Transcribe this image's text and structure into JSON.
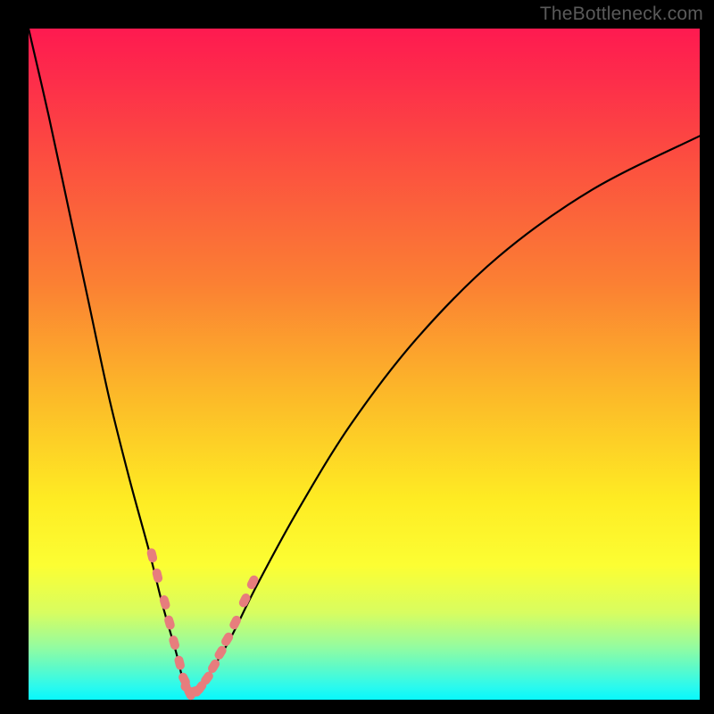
{
  "watermark": "TheBottleneck.com",
  "colors": {
    "frame": "#000000",
    "curve": "#000000",
    "marker": "#e77d7d"
  },
  "chart_data": {
    "type": "line",
    "title": "",
    "xlabel": "",
    "ylabel": "",
    "xlim": [
      0,
      100
    ],
    "ylim": [
      0,
      100
    ],
    "grid": false,
    "description": "V-shaped bottleneck curve with minimum near x≈24. Background gradient encodes severity (red top → green bottom). Coral markers highlight points near the minimum.",
    "series": [
      {
        "name": "bottleneck-curve",
        "x": [
          0,
          3,
          6,
          9,
          12,
          15,
          18,
          20,
          22,
          23,
          24,
          25,
          27,
          30,
          34,
          40,
          48,
          58,
          70,
          84,
          100
        ],
        "values": [
          100,
          87,
          73,
          59,
          45,
          33,
          22,
          14,
          7,
          3,
          1,
          1.3,
          4,
          9,
          17,
          28,
          41,
          54,
          66,
          76,
          84
        ]
      }
    ],
    "markers": {
      "name": "highlighted-points",
      "x": [
        18.4,
        19.2,
        20.3,
        21.0,
        21.7,
        22.5,
        23.2,
        24.0,
        24.8,
        25.6,
        26.6,
        27.6,
        28.6,
        29.6,
        30.8,
        32.2,
        33.4
      ],
      "values": [
        21.5,
        18.5,
        14.5,
        11.5,
        8.5,
        5.5,
        3.0,
        1.0,
        1.3,
        1.8,
        3.2,
        5.0,
        7.0,
        9.0,
        11.5,
        14.8,
        17.5
      ]
    }
  }
}
